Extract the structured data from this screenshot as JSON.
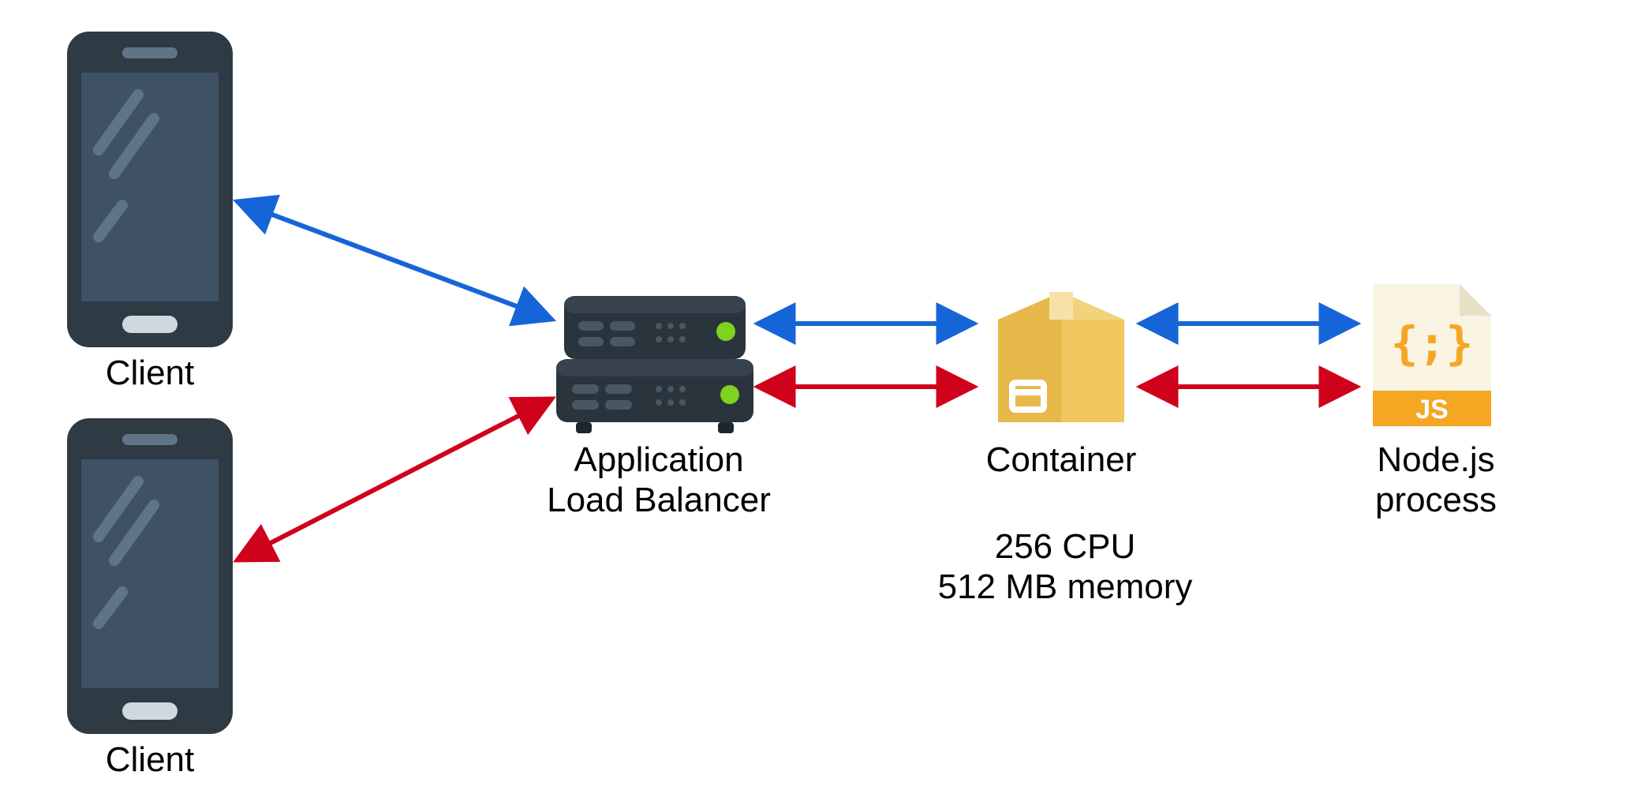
{
  "nodes": {
    "client_top": {
      "label": "Client"
    },
    "client_bottom": {
      "label": "Client"
    },
    "load_balancer": {
      "label": "Application\nLoad Balancer"
    },
    "container": {
      "label": "Container",
      "spec": "256 CPU\n512 MB memory"
    },
    "nodejs": {
      "label": "Node.js\nprocess",
      "js_badge": "JS"
    }
  },
  "arrows": [
    {
      "from": "client_top",
      "to": "load_balancer",
      "color": "blue"
    },
    {
      "from": "client_bottom",
      "to": "load_balancer",
      "color": "red"
    },
    {
      "from": "load_balancer",
      "to": "container",
      "color": "blue",
      "lane": "top"
    },
    {
      "from": "load_balancer",
      "to": "container",
      "color": "red",
      "lane": "bottom"
    },
    {
      "from": "container",
      "to": "nodejs",
      "color": "blue",
      "lane": "top"
    },
    {
      "from": "container",
      "to": "nodejs",
      "color": "red",
      "lane": "bottom"
    }
  ],
  "colors": {
    "blue": "#1665d8",
    "red": "#d0021b",
    "phone_body": "#2e3a44",
    "phone_screen": "#3e5165",
    "phone_highlight": "#5f7486",
    "server_body": "#2a343d",
    "server_top": "#38424c",
    "server_led": "#7ed321",
    "box_main": "#efc75e",
    "box_tape": "#f6e2a8",
    "box_dark": "#d9a63d",
    "js_orange": "#f5a623",
    "page_cream": "#f8f3e3"
  }
}
